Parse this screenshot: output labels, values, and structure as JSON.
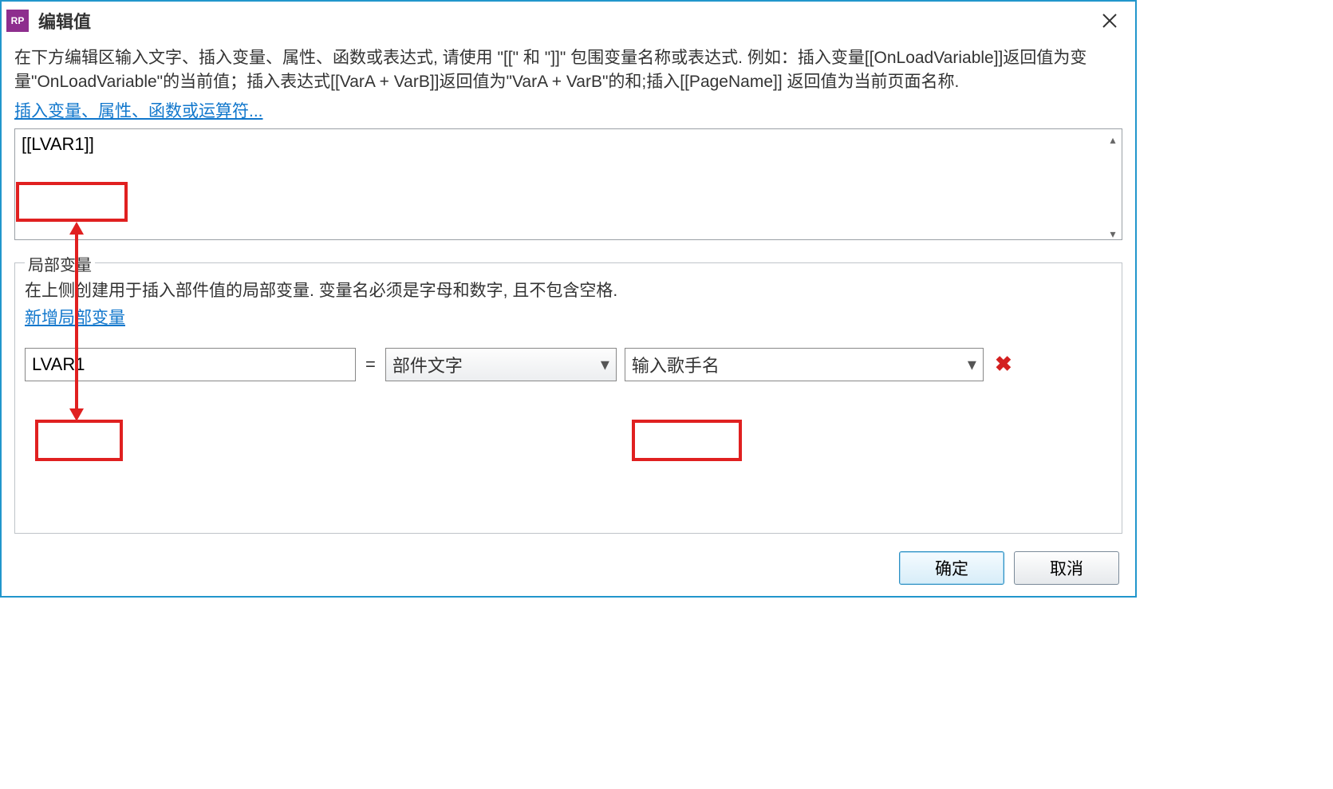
{
  "dialog": {
    "title": "编辑值",
    "help_text": "在下方编辑区输入文字、插入变量、属性、函数或表达式, 请使用 \"[[\" 和 \"]]\" 包围变量名称或表达式. 例如：插入变量[[OnLoadVariable]]返回值为变量\"OnLoadVariable\"的当前值；插入表达式[[VarA + VarB]]返回值为\"VarA + VarB\"的和;插入[[PageName]] 返回值为当前页面名称.",
    "insert_link": "插入变量、属性、函数或运算符...",
    "expression_value": "[[LVAR1]]"
  },
  "local_vars": {
    "legend": "局部变量",
    "help": "在上侧创建用于插入部件值的局部变量. 变量名必须是字母和数字, 且不包含空格.",
    "add_link": "新增局部变量",
    "row": {
      "name": "LVAR1",
      "equals": "=",
      "type": "部件文字",
      "target": "输入歌手名"
    }
  },
  "buttons": {
    "ok": "确定",
    "cancel": "取消"
  },
  "icons": {
    "app": "RP"
  }
}
